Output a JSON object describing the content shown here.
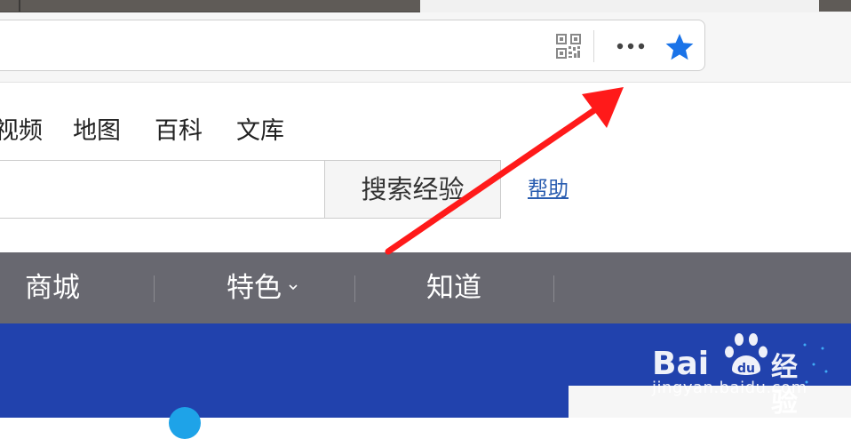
{
  "browser": {
    "url_bar": {
      "value": ""
    },
    "icons": {
      "qr": "qr-code-icon",
      "more": "more-icon",
      "favorite": "star-icon"
    },
    "accent_color": "#1a73e8"
  },
  "page": {
    "nav_links": [
      "视频",
      "地图",
      "百科",
      "文库"
    ],
    "search": {
      "value": "",
      "button_label": "搜索经验"
    },
    "help_label": "帮助",
    "dark_nav": {
      "items": [
        "商城",
        "特色",
        "知道"
      ],
      "background": "#686870"
    },
    "banner": {
      "background": "#2142ad",
      "logo": {
        "text_left": "Bai",
        "text_mid": "du",
        "text_right": "经验",
        "url": "jingyan.baidu.com"
      }
    }
  },
  "annotation": {
    "arrow_color": "#ff1a1a",
    "points_to": "more-icon"
  }
}
